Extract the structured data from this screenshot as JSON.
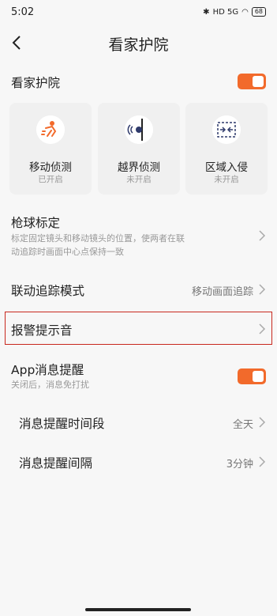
{
  "status_bar": {
    "time": "5:02",
    "signal_text": "HD 5G",
    "battery": "68"
  },
  "nav": {
    "title": "看家护院"
  },
  "guard": {
    "label": "看家护院",
    "enabled": true,
    "cards": [
      {
        "title": "移动侦测",
        "status": "已开启",
        "icon": "motion-icon"
      },
      {
        "title": "越界侦测",
        "status": "未开启",
        "icon": "line-crossing-icon"
      },
      {
        "title": "区域入侵",
        "status": "未开启",
        "icon": "intrusion-icon"
      }
    ]
  },
  "gun_calibration": {
    "label": "枪球标定",
    "desc_line1": "标定固定镜头和移动镜头的位置，使两者在联",
    "desc_line2": "动追踪时画面中心点保持一致"
  },
  "tracking_mode": {
    "label": "联动追踪模式",
    "value": "移动画面追踪"
  },
  "alarm_sound": {
    "label": "报警提示音"
  },
  "app_notify": {
    "label": "App消息提醒",
    "desc": "关闭后，消息免打扰",
    "enabled": true
  },
  "notify_period": {
    "label": "消息提醒时间段",
    "value": "全天"
  },
  "notify_interval": {
    "label": "消息提醒间隔",
    "value": "3分钟"
  },
  "colors": {
    "accent": "#f26a2b",
    "highlight_border": "#c8281e"
  }
}
